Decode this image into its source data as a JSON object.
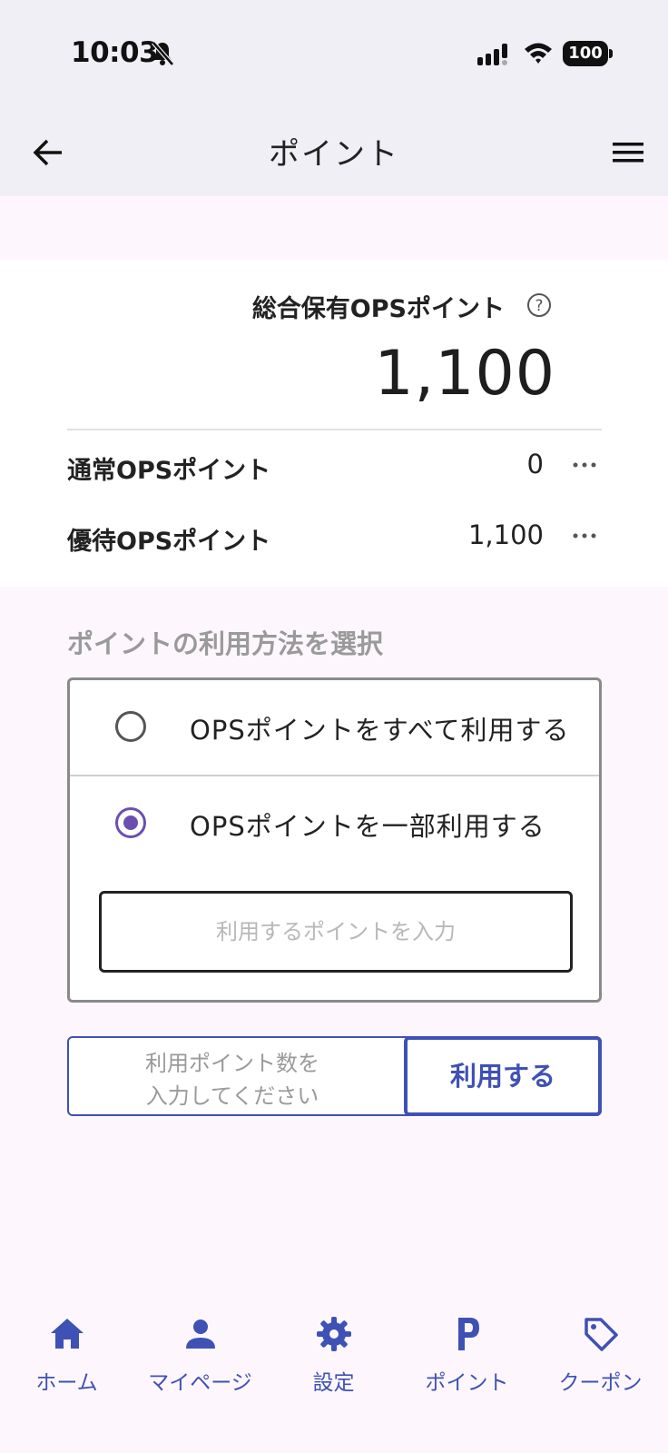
{
  "status_bar": {
    "time": "10:03",
    "battery": "100"
  },
  "header": {
    "title": "ポイント",
    "back_icon": "arrow-left-icon",
    "menu_icon": "hamburger-menu-icon"
  },
  "points_summary": {
    "total_label": "総合保有OPSポイント",
    "total_value": "1,100",
    "rows": [
      {
        "label": "通常OPSポイント",
        "value": "0"
      },
      {
        "label": "優待OPSポイント",
        "value": "1,100"
      }
    ]
  },
  "usage": {
    "section_title": "ポイントの利用方法を選択",
    "options": [
      {
        "label": "OPSポイントをすべて利用する",
        "selected": false
      },
      {
        "label": "OPSポイントを一部利用する",
        "selected": true
      }
    ],
    "input_placeholder": "利用するポイントを入力",
    "input_value": ""
  },
  "action": {
    "hint": "利用ポイント数を\n入力してください",
    "button_label": "利用する"
  },
  "bottom_nav": {
    "items": [
      {
        "label": "ホーム",
        "icon": "home-icon"
      },
      {
        "label": "マイページ",
        "icon": "person-icon"
      },
      {
        "label": "設定",
        "icon": "gear-icon"
      },
      {
        "label": "ポイント",
        "icon": "points-p-icon"
      },
      {
        "label": "クーポン",
        "icon": "tag-icon"
      }
    ]
  },
  "colors": {
    "accent": "#3f51b5",
    "radio_selected": "#6b4fb0",
    "header_bg": "#f0eff5",
    "page_bg": "#fdf7fd"
  }
}
